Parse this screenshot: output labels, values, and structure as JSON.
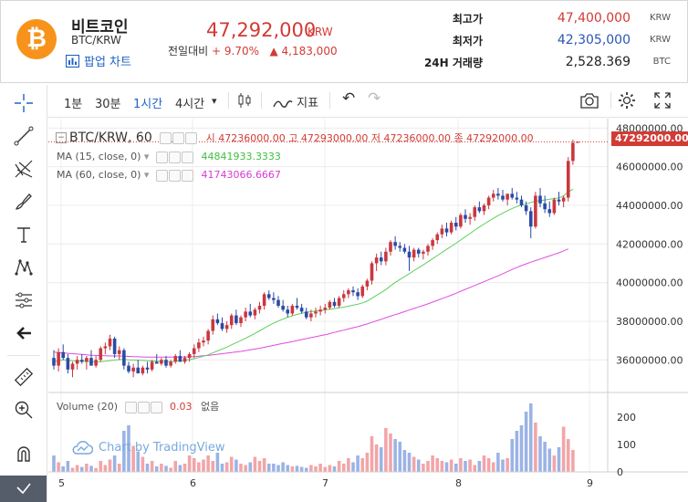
{
  "header": {
    "coin_symbol": "₿",
    "coin_name": "비트코인",
    "pair": "BTC/KRW",
    "popup_chart_label": "팝업 차트",
    "price": "47,292,000",
    "price_unit": "KRW",
    "change_label": "전일대비",
    "change_pct": "+ 9.70%",
    "change_arrow": "▲",
    "change_amount": "4,183,000",
    "stats": [
      {
        "label": "최고가",
        "value": "47,400,000",
        "unit": "KRW",
        "color": "#d23b35"
      },
      {
        "label": "최저가",
        "value": "42,305,000",
        "unit": "KRW",
        "color": "#2a56b5"
      },
      {
        "label": "24H 거래량",
        "value": "2,528.369",
        "unit": "BTC",
        "color": "#222222"
      }
    ]
  },
  "toolbar": {
    "intervals": [
      "1분",
      "30분",
      "1시간",
      "4시간"
    ],
    "active_interval": "1시간",
    "interval_dropdown": "▾",
    "indicators_label": "지표",
    "undo": "↶",
    "redo": "↷"
  },
  "chart": {
    "series_title": "BTC/KRW, 60",
    "ohlc": {
      "o_label": "시",
      "o": "47236000.00",
      "h_label": "고",
      "h": "47293000.00",
      "l_label": "저",
      "l": "47236000.00",
      "c_label": "종",
      "c": "47292000.00"
    },
    "ma15_label": "MA (15, close, 0)",
    "ma15_value": "44841933.3333",
    "ma60_label": "MA (60, close, 0)",
    "ma60_value": "41743066.6667",
    "volume_label": "Volume (20)",
    "volume_value": "0.03",
    "volume_extra": "없음",
    "last_price_tag": "47292000.00",
    "watermark": "Chart by TradingView",
    "colors": {
      "up": "#c9383e",
      "down": "#2b4aa6",
      "ma15": "#5dd05d",
      "ma60": "#e04be0",
      "vol_up": "#f2a5a8",
      "vol_down": "#9bb3e5",
      "grid": "#ececec"
    }
  },
  "chart_data": {
    "type": "candlestick",
    "x_tick_labels": [
      "5",
      "6",
      "7",
      "8",
      "9"
    ],
    "y_tick_labels": [
      "36000000.00",
      "38000000.00",
      "40000000.00",
      "42000000.00",
      "44000000.00",
      "46000000.00",
      "48000000.00"
    ],
    "ylim": [
      34500000,
      48300000
    ],
    "volume_tick_labels": [
      "0",
      "100",
      "200"
    ],
    "volume_ylim": [
      0,
      260
    ],
    "candles": [
      [
        36100000,
        36500000,
        35500000,
        35700000
      ],
      [
        35700000,
        36600000,
        35400000,
        36400000
      ],
      [
        36400000,
        36800000,
        36000000,
        36100000
      ],
      [
        36100000,
        36300000,
        35300000,
        35500000
      ],
      [
        35500000,
        35900000,
        35100000,
        35800000
      ],
      [
        35800000,
        36200000,
        35500000,
        36000000
      ],
      [
        36000000,
        36300000,
        35800000,
        35900000
      ],
      [
        35900000,
        36200000,
        35500000,
        36100000
      ],
      [
        36100000,
        36500000,
        35800000,
        35700000
      ],
      [
        35700000,
        36200000,
        35600000,
        36000000
      ],
      [
        36000000,
        36700000,
        35900000,
        36600000
      ],
      [
        36600000,
        36900000,
        36300000,
        36700000
      ],
      [
        36700000,
        37300000,
        36500000,
        37100000
      ],
      [
        37100000,
        37200000,
        36100000,
        36300000
      ],
      [
        36300000,
        36700000,
        36000000,
        36500000
      ],
      [
        36500000,
        36600000,
        35500000,
        35700000
      ],
      [
        35700000,
        35900000,
        35300000,
        35400000
      ],
      [
        35400000,
        35800000,
        35100000,
        35600000
      ],
      [
        35600000,
        36000000,
        35300000,
        35300000
      ],
      [
        35300000,
        35700000,
        35200000,
        35600000
      ],
      [
        35600000,
        35900000,
        35300000,
        35500000
      ],
      [
        35500000,
        36000000,
        35400000,
        35900000
      ],
      [
        35900000,
        36300000,
        35800000,
        35800000
      ],
      [
        35800000,
        36100000,
        35700000,
        36000000
      ],
      [
        36000000,
        36200000,
        35600000,
        35700000
      ],
      [
        35700000,
        36000000,
        35600000,
        35900000
      ],
      [
        35900000,
        36300000,
        35800000,
        36200000
      ],
      [
        36200000,
        36500000,
        35900000,
        35900000
      ],
      [
        35900000,
        36200000,
        35800000,
        36100000
      ],
      [
        36100000,
        36400000,
        35900000,
        36300000
      ],
      [
        36300000,
        36800000,
        36100000,
        36600000
      ],
      [
        36600000,
        37100000,
        36400000,
        36900000
      ],
      [
        36900000,
        37200000,
        36700000,
        37000000
      ],
      [
        37000000,
        37600000,
        36800000,
        37500000
      ],
      [
        37500000,
        38300000,
        37300000,
        38100000
      ],
      [
        38100000,
        38400000,
        37800000,
        37900000
      ],
      [
        37900000,
        38200000,
        37500000,
        37600000
      ],
      [
        37600000,
        38000000,
        37400000,
        37800000
      ],
      [
        37800000,
        38400000,
        37600000,
        38300000
      ],
      [
        38300000,
        38600000,
        37800000,
        37900000
      ],
      [
        37900000,
        38300000,
        37700000,
        38200000
      ],
      [
        38200000,
        38700000,
        38000000,
        38500000
      ],
      [
        38500000,
        38900000,
        38200000,
        38300000
      ],
      [
        38300000,
        38700000,
        38100000,
        38600000
      ],
      [
        38600000,
        39000000,
        38400000,
        38800000
      ],
      [
        38800000,
        39500000,
        38600000,
        39400000
      ],
      [
        39400000,
        39600000,
        39100000,
        39200000
      ],
      [
        39200000,
        39500000,
        38900000,
        39100000
      ],
      [
        39100000,
        39300000,
        38700000,
        38800000
      ],
      [
        38800000,
        39100000,
        38500000,
        38600000
      ],
      [
        38600000,
        38800000,
        38200000,
        38400000
      ],
      [
        38400000,
        38900000,
        38300000,
        38800000
      ],
      [
        38800000,
        39200000,
        38600000,
        38700000
      ],
      [
        38700000,
        38900000,
        38400000,
        38500000
      ],
      [
        38500000,
        38700000,
        38100000,
        38200000
      ],
      [
        38200000,
        38600000,
        38000000,
        38400000
      ],
      [
        38400000,
        38700000,
        38200000,
        38500000
      ],
      [
        38500000,
        38800000,
        38300000,
        38600000
      ],
      [
        38600000,
        38900000,
        38400000,
        38700000
      ],
      [
        38700000,
        39100000,
        38600000,
        39000000
      ],
      [
        39000000,
        39200000,
        38700000,
        38800000
      ],
      [
        38800000,
        39300000,
        38700000,
        39200000
      ],
      [
        39200000,
        39600000,
        39000000,
        39400000
      ],
      [
        39400000,
        39700000,
        39200000,
        39600000
      ],
      [
        39600000,
        39800000,
        39300000,
        39500000
      ],
      [
        39500000,
        39700000,
        39100000,
        39300000
      ],
      [
        39300000,
        39900000,
        39200000,
        39800000
      ],
      [
        39800000,
        40200000,
        39600000,
        40100000
      ],
      [
        40100000,
        41100000,
        39900000,
        41000000
      ],
      [
        41000000,
        41500000,
        40600000,
        41300000
      ],
      [
        41300000,
        41600000,
        40900000,
        41100000
      ],
      [
        41100000,
        41800000,
        40900000,
        41600000
      ],
      [
        41600000,
        42200000,
        41400000,
        42100000
      ],
      [
        42100000,
        42400000,
        41700000,
        41900000
      ],
      [
        41900000,
        42100000,
        41600000,
        41800000
      ],
      [
        41800000,
        42000000,
        41500000,
        41600000
      ],
      [
        41600000,
        41900000,
        40600000,
        41300000
      ],
      [
        41300000,
        41800000,
        41100000,
        41700000
      ],
      [
        41700000,
        41800000,
        41300000,
        41500000
      ],
      [
        41500000,
        41700000,
        41200000,
        41600000
      ],
      [
        41600000,
        42000000,
        41400000,
        41900000
      ],
      [
        41900000,
        42300000,
        41700000,
        42200000
      ],
      [
        42200000,
        42600000,
        42000000,
        42500000
      ],
      [
        42500000,
        43000000,
        42300000,
        42800000
      ],
      [
        42800000,
        43100000,
        42400000,
        42600000
      ],
      [
        42600000,
        43200000,
        42500000,
        43100000
      ],
      [
        43100000,
        43400000,
        42700000,
        42900000
      ],
      [
        42900000,
        43600000,
        42800000,
        43500000
      ],
      [
        43500000,
        43800000,
        43100000,
        43300000
      ],
      [
        43300000,
        43600000,
        43000000,
        43400000
      ],
      [
        43400000,
        44000000,
        43200000,
        43900000
      ],
      [
        43900000,
        44200000,
        43600000,
        43700000
      ],
      [
        43700000,
        44100000,
        43500000,
        44000000
      ],
      [
        44000000,
        44500000,
        43800000,
        44400000
      ],
      [
        44400000,
        44800000,
        44200000,
        44600000
      ],
      [
        44600000,
        44900000,
        44300000,
        44500000
      ],
      [
        44500000,
        44800000,
        44200000,
        44300000
      ],
      [
        44300000,
        44600000,
        44000000,
        44600000
      ],
      [
        44600000,
        44900000,
        44300000,
        44400000
      ],
      [
        44400000,
        44700000,
        44100000,
        44300000
      ],
      [
        44300000,
        44500000,
        43900000,
        44000000
      ],
      [
        44000000,
        44200000,
        43500000,
        43700000
      ],
      [
        43700000,
        43900000,
        42300000,
        42900000
      ],
      [
        42900000,
        44700000,
        42800000,
        44500000
      ],
      [
        44500000,
        44900000,
        43900000,
        44100000
      ],
      [
        44100000,
        44500000,
        43600000,
        43800000
      ],
      [
        43800000,
        44200000,
        43400000,
        43600000
      ],
      [
        43600000,
        44400000,
        43500000,
        44300000
      ],
      [
        44300000,
        44700000,
        44000000,
        44200000
      ],
      [
        44200000,
        44500000,
        43900000,
        44400000
      ],
      [
        44400000,
        46500000,
        44200000,
        46300000
      ],
      [
        46300000,
        47400000,
        46100000,
        47236000
      ],
      [
        47236000,
        47293000,
        47236000,
        47292000
      ]
    ],
    "ma15": [
      35900000,
      35950000,
      36000000,
      35980000,
      35950000,
      35940000,
      35930000,
      35920000,
      35910000,
      35900000,
      35910000,
      35930000,
      35960000,
      35990000,
      36010000,
      36020000,
      36000000,
      35990000,
      35980000,
      35970000,
      35950000,
      35940000,
      35930000,
      35920000,
      35920000,
      35910000,
      35930000,
      35950000,
      35970000,
      36010000,
      36060000,
      36120000,
      36190000,
      36260000,
      36360000,
      36460000,
      36560000,
      36660000,
      36780000,
      36890000,
      37000000,
      37120000,
      37240000,
      37370000,
      37500000,
      37640000,
      37780000,
      37900000,
      38010000,
      38110000,
      38200000,
      38280000,
      38350000,
      38410000,
      38460000,
      38500000,
      38530000,
      38560000,
      38590000,
      38620000,
      38650000,
      38690000,
      38730000,
      38780000,
      38830000,
      38880000,
      38950000,
      39040000,
      39190000,
      39340000,
      39480000,
      39640000,
      39830000,
      40000000,
      40160000,
      40310000,
      40460000,
      40620000,
      40770000,
      40920000,
      41080000,
      41240000,
      41400000,
      41560000,
      41720000,
      41880000,
      42040000,
      42210000,
      42380000,
      42540000,
      42720000,
      42880000,
      43030000,
      43180000,
      43330000,
      43470000,
      43600000,
      43720000,
      43840000,
      43940000,
      44020000,
      44060000,
      44150000,
      44210000,
      44250000,
      44280000,
      44320000,
      44350000,
      44380000,
      44500000,
      44690000,
      44840000
    ],
    "ma60": [
      36400000,
      36380000,
      36360000,
      36340000,
      36320000,
      36300000,
      36280000,
      36260000,
      36240000,
      36230000,
      36220000,
      36210000,
      36200000,
      36200000,
      36200000,
      36190000,
      36180000,
      36170000,
      36160000,
      36150000,
      36140000,
      36140000,
      36140000,
      36140000,
      36140000,
      36140000,
      36140000,
      36140000,
      36150000,
      36160000,
      36170000,
      36190000,
      36210000,
      36230000,
      36260000,
      36290000,
      36320000,
      36350000,
      36380000,
      36410000,
      36440000,
      36480000,
      36520000,
      36560000,
      36600000,
      36650000,
      36700000,
      36750000,
      36800000,
      36850000,
      36900000,
      36950000,
      37000000,
      37050000,
      37100000,
      37150000,
      37200000,
      37250000,
      37300000,
      37360000,
      37420000,
      37480000,
      37540000,
      37600000,
      37660000,
      37720000,
      37790000,
      37860000,
      37940000,
      38020000,
      38100000,
      38180000,
      38260000,
      38340000,
      38420000,
      38500000,
      38580000,
      38660000,
      38740000,
      38820000,
      38900000,
      38990000,
      39080000,
      39170000,
      39260000,
      39350000,
      39450000,
      39550000,
      39650000,
      39750000,
      39850000,
      39950000,
      40050000,
      40150000,
      40250000,
      40350000,
      40460000,
      40570000,
      40680000,
      40780000,
      40880000,
      40970000,
      41060000,
      41140000,
      41220000,
      41300000,
      41380000,
      41460000,
      41540000,
      41640000,
      41743000
    ],
    "volumes": [
      60,
      35,
      20,
      40,
      15,
      25,
      18,
      30,
      22,
      14,
      40,
      25,
      45,
      60,
      30,
      150,
      170,
      95,
      75,
      55,
      30,
      40,
      20,
      30,
      22,
      15,
      40,
      25,
      30,
      60,
      50,
      35,
      45,
      60,
      40,
      70,
      30,
      35,
      55,
      45,
      30,
      25,
      35,
      55,
      40,
      50,
      30,
      30,
      25,
      35,
      25,
      20,
      22,
      18,
      15,
      25,
      20,
      30,
      18,
      25,
      20,
      40,
      30,
      50,
      35,
      60,
      50,
      70,
      130,
      100,
      90,
      160,
      140,
      120,
      110,
      80,
      70,
      55,
      45,
      30,
      40,
      60,
      50,
      40,
      35,
      45,
      30,
      50,
      40,
      45,
      25,
      40,
      60,
      50,
      35,
      70,
      45,
      50,
      120,
      150,
      170,
      220,
      250,
      180,
      130,
      110,
      85,
      60,
      90,
      165,
      120,
      80
    ]
  }
}
